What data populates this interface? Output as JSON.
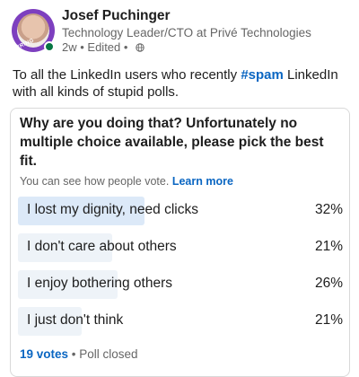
{
  "post": {
    "author_name": "Josef Puchinger",
    "author_headline": "Technology Leader/CTO at Privé Technologies",
    "timestamp": "2w",
    "separator": " • ",
    "edited": "Edited",
    "separator2": " • ",
    "visibility_icon": "globe-icon",
    "avatar_badge": "HIRING",
    "text_before": "To all the LinkedIn users who recently ",
    "hashtag": "#spam",
    "text_after": " LinkedIn with all kinds of stupid polls."
  },
  "poll": {
    "question": "Why are you doing that? Unfortunately no multiple choice available, please pick the best fit.",
    "visibility_note": "You can see how people vote. ",
    "learn_more": "Learn more",
    "options": [
      {
        "label": "I lost my dignity, need clicks",
        "percent": "32%",
        "share": 0.32,
        "selected": true
      },
      {
        "label": "I don't care about others",
        "percent": "21%",
        "share": 0.21,
        "selected": false
      },
      {
        "label": "I enjoy bothering others",
        "percent": "26%",
        "share": 0.26,
        "selected": false
      },
      {
        "label": "I just don't think",
        "percent": "21%",
        "share": 0.21,
        "selected": false
      }
    ],
    "votes": "19 votes",
    "separator": " • ",
    "status": "Poll closed"
  },
  "colors": {
    "link": "#0a66c2",
    "bar": "#eef3f8",
    "bar_selected": "#dce9f8",
    "online": "#057642"
  }
}
